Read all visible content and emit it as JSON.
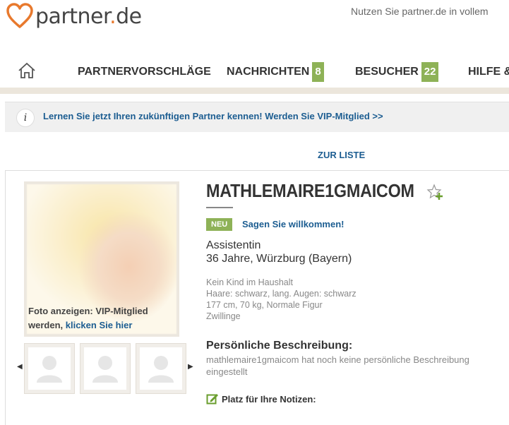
{
  "header": {
    "logo_text_left": "partner",
    "logo_text_dot": ".",
    "logo_text_right": "de",
    "promo": "Nutzen Sie partner.de in vollem",
    "brand_color": "#e8792d"
  },
  "nav": {
    "home_icon": "home-icon",
    "items": [
      {
        "label": "PARTNERVORSCHLÄGE"
      },
      {
        "label": "NACHRICHTEN",
        "badge": "8"
      },
      {
        "label": "BESUCHER",
        "badge": "22"
      },
      {
        "label": "HILFE &"
      }
    ],
    "badge_color": "#8eb257"
  },
  "infobar": {
    "icon": "i",
    "text": "Lernen Sie jetzt Ihren zukünftigen Partner kennen! Werden Sie VIP-Mitglied >>"
  },
  "zur_liste": "ZUR LISTE",
  "photo": {
    "caption_text": "Foto anzeigen: VIP-Mitglied werden, ",
    "caption_link": "klicken Sie hier"
  },
  "profile": {
    "username": "MATHLEMAIRE1GMAICOM",
    "new_badge": "NEU",
    "welcome_link": "Sagen Sie willkommen!",
    "job": "Assistentin",
    "age_city": "36 Jahre, Würzburg (Bayern)",
    "details": [
      "Kein Kind im Haushalt",
      "Haare: schwarz, lang. Augen: schwarz",
      "177 cm, 70 kg, Normale Figur",
      "Zwillinge"
    ],
    "description_heading": "Persönliche Beschreibung:",
    "description_text": "mathlemaire1gmaicom hat noch keine persönliche Beschreibung eingestellt",
    "notes_label": "Platz für Ihre Notizen:"
  }
}
